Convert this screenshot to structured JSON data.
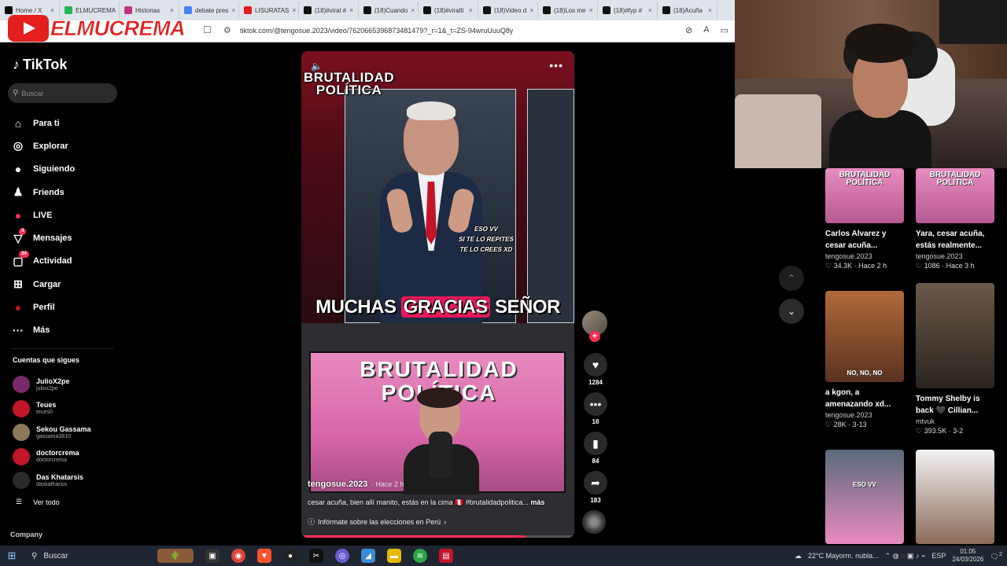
{
  "browser": {
    "tabs": [
      {
        "label": "Home / X",
        "color": "#000000"
      },
      {
        "label": "ELMUCREMA",
        "color": "#1db954"
      },
      {
        "label": "Historias",
        "color": "#c13584"
      },
      {
        "label": "debate pres",
        "color": "#4285f4"
      },
      {
        "label": "LISURATAS",
        "color": "#e41d1d"
      },
      {
        "label": "(18)#viral #",
        "color": "#111111"
      },
      {
        "label": "(18)Cuando",
        "color": "#111111"
      },
      {
        "label": "(18)#viralti",
        "color": "#111111"
      },
      {
        "label": "(18)Video d",
        "color": "#111111"
      },
      {
        "label": "(18)Los me",
        "color": "#111111"
      },
      {
        "label": "(18)#fyp #",
        "color": "#111111"
      },
      {
        "label": "(18)Acuña",
        "color": "#111111"
      }
    ],
    "url": "tiktok.com/@tengosue.2023/video/7620665396873481479?_r=1&_t=ZS-94wruUuuQ8y"
  },
  "overlay_logo": "ELMUCREMA",
  "tiktok": {
    "brand": "TikTok",
    "search_placeholder": "Buscar",
    "nav": [
      {
        "label": "Para ti",
        "icon": "home-icon"
      },
      {
        "label": "Explorar",
        "icon": "compass-icon"
      },
      {
        "label": "Siguiendo",
        "icon": "following-icon"
      },
      {
        "label": "Friends",
        "icon": "friends-icon"
      },
      {
        "label": "LIVE",
        "icon": "live-icon"
      },
      {
        "label": "Mensajes",
        "icon": "messages-icon",
        "badge": "4"
      },
      {
        "label": "Actividad",
        "icon": "activity-icon",
        "badge": "34"
      },
      {
        "label": "Cargar",
        "icon": "upload-icon"
      },
      {
        "label": "Perfil",
        "icon": "profile-icon"
      },
      {
        "label": "Más",
        "icon": "more-icon"
      }
    ],
    "following_title": "Cuentas que sigues",
    "following": [
      {
        "name": "JulioX2pe",
        "handle": "juliox2pe",
        "color": "#7a2a6a"
      },
      {
        "name": "Teues",
        "handle": "teues0",
        "color": "#c4142a"
      },
      {
        "name": "Sekou Gassama",
        "handle": "gassama3810",
        "color": "#8a7a5a"
      },
      {
        "name": "doctorcrema",
        "handle": "doctorcrema",
        "color": "#c4142a"
      },
      {
        "name": "Das Khatarsis",
        "handle": "daskatharsis",
        "color": "#2a2a2a"
      }
    ],
    "see_all": "Ver todo",
    "company": "Company"
  },
  "video": {
    "overlay_title_1": "BRUTALIDAD",
    "overlay_title_2": "POLÍTICA",
    "caption_small": "ESO VV\nSI TE LO REPITES\nTE LO CREES XD",
    "caption_big_1": "MUCHAS",
    "caption_big_hl": "GRACIAS",
    "caption_big_2": "SEÑOR",
    "inset_title_1": "BRUTALIDAD",
    "inset_title_2": "POLÍTICA",
    "author": "tengosue.2023",
    "time": "· Hace 2 h",
    "description": "cesar acuña, bien allí manito, estás en la cima 🇵🇪 #brutalidadpolitica...",
    "more_label": "más",
    "info": "Infórmate sobre las elecciones en Perú",
    "progress": 0.82
  },
  "actions": {
    "likes": "1284",
    "comments": "16",
    "saves": "84",
    "shares": "183"
  },
  "recommendations": [
    {
      "title": "Carlos Alvarez y\ncesar acuña...",
      "author": "tengosue.2023",
      "stats": "♡ 34.3K · Hace 2 h",
      "thumb": "BRUTALIDAD POLÍTICA"
    },
    {
      "title": "Yara, cesar acuña,\nestás realmente...",
      "author": "tengosue.2023",
      "stats": "♡ 1086 · Hace 3 h",
      "thumb": "BRUTALIDAD POLÍTICA"
    },
    {
      "title": "a kgon, a\namenazando xd...",
      "author": "tengosue.2023",
      "stats": "♡ 28K · 3-13",
      "thumb": "NO, NO, NO"
    },
    {
      "title": "Tommy Shelby is\nback 🖤 Cillian...",
      "author": "mtvuk",
      "stats": "♡ 393.5K · 3-2",
      "thumb": ""
    },
    {
      "title": "",
      "author": "",
      "stats": "",
      "thumb": "ESO VV"
    },
    {
      "title": "",
      "author": "",
      "stats": "",
      "thumb": ""
    }
  ],
  "taskbar": {
    "search": "Buscar",
    "weather": "22°C  Mayorm. nubla...",
    "lang": "ESP",
    "time": "01:05",
    "date": "24/03/2026",
    "notifications": "2"
  }
}
